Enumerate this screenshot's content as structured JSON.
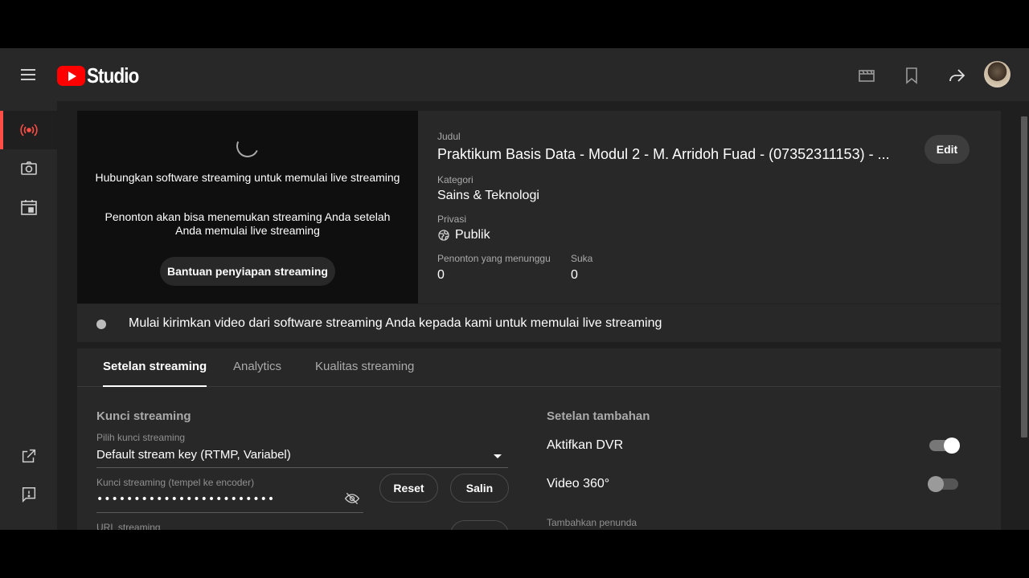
{
  "app": {
    "logo_text": "Studio"
  },
  "header": {
    "icons": [
      "clapperboard-icon",
      "bookmark-icon",
      "share-icon"
    ]
  },
  "rail": {
    "items": [
      {
        "name": "live-stream-icon",
        "active": true
      },
      {
        "name": "webcam-icon",
        "active": false
      },
      {
        "name": "calendar-icon",
        "active": false
      },
      {
        "name": "external-link-icon",
        "active": false
      },
      {
        "name": "feedback-icon",
        "active": false
      }
    ]
  },
  "preview": {
    "message1": "Hubungkan software streaming untuk memulai live streaming",
    "message2": "Penonton akan bisa menemukan streaming Anda setelah Anda memulai live streaming",
    "help_button": "Bantuan penyiapan streaming"
  },
  "info": {
    "title_label": "Judul",
    "title_value": "Praktikum Basis Data - Modul 2 - M. Arridoh Fuad - (07352311153) - ...",
    "category_label": "Kategori",
    "category_value": "Sains & Teknologi",
    "privacy_label": "Privasi",
    "privacy_value": "Publik",
    "waiting_label": "Penonton yang menunggu",
    "waiting_value": "0",
    "likes_label": "Suka",
    "likes_value": "0",
    "edit_button": "Edit"
  },
  "status": {
    "text": "Mulai kirimkan video dari software streaming Anda kepada kami untuk memulai live streaming"
  },
  "tabs": [
    {
      "label": "Setelan streaming",
      "active": true
    },
    {
      "label": "Analytics",
      "active": false
    },
    {
      "label": "Kualitas streaming",
      "active": false
    }
  ],
  "stream_key": {
    "section_title": "Kunci streaming",
    "select_label": "Pilih kunci streaming",
    "select_value": "Default stream key (RTMP, Variabel)",
    "key_label": "Kunci streaming (tempel ke encoder)",
    "key_value": "••••••••••••••••••••••••",
    "reset_button": "Reset",
    "copy_button": "Salin",
    "url_label": "URL streaming"
  },
  "extra": {
    "section_title": "Setelan tambahan",
    "dvr_label": "Aktifkan DVR",
    "dvr_on": true,
    "video360_label": "Video 360°",
    "video360_on": false,
    "delay_label": "Tambahkan penunda"
  },
  "colors": {
    "accent": "#ff0000",
    "active_rail": "#ff4e45",
    "background": "#1f1f1f",
    "surface": "#282828"
  }
}
